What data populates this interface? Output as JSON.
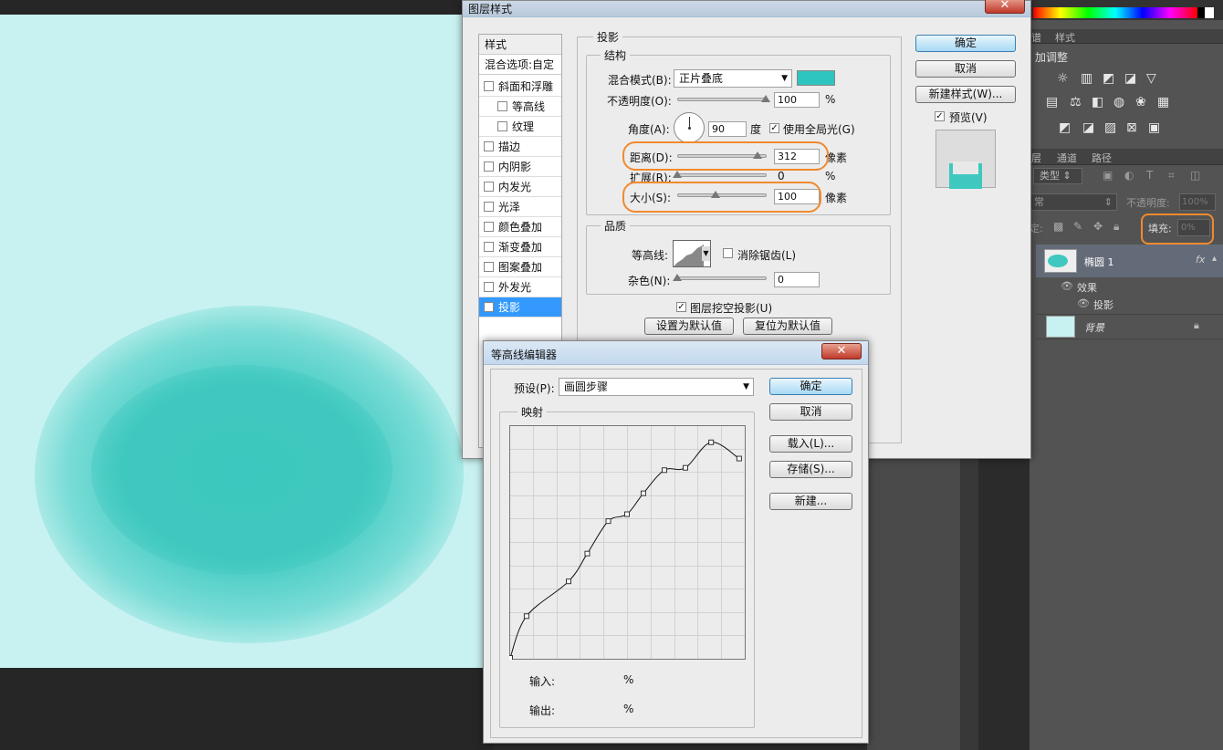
{
  "layer_style": {
    "title": "图层样式",
    "close": "✕",
    "sidebar": {
      "header": "样式",
      "blend_options": "混合选项:自定",
      "items": [
        {
          "label": "斜面和浮雕",
          "checked": false,
          "indent": false
        },
        {
          "label": "等高线",
          "checked": false,
          "indent": true
        },
        {
          "label": "纹理",
          "checked": false,
          "indent": true
        },
        {
          "label": "描边",
          "checked": false,
          "indent": false
        },
        {
          "label": "内阴影",
          "checked": false,
          "indent": false
        },
        {
          "label": "内发光",
          "checked": false,
          "indent": false
        },
        {
          "label": "光泽",
          "checked": false,
          "indent": false
        },
        {
          "label": "颜色叠加",
          "checked": false,
          "indent": false
        },
        {
          "label": "渐变叠加",
          "checked": false,
          "indent": false
        },
        {
          "label": "图案叠加",
          "checked": false,
          "indent": false
        },
        {
          "label": "外发光",
          "checked": false,
          "indent": false
        },
        {
          "label": "投影",
          "checked": true,
          "indent": false,
          "selected": true
        }
      ]
    },
    "section_title": "投影",
    "structure": {
      "title": "结构",
      "blend_mode_label": "混合模式(B):",
      "blend_mode_value": "正片叠底",
      "blend_color": "#2ec4bf",
      "opacity_label": "不透明度(O):",
      "opacity_value": "100",
      "percent": "%",
      "angle_label": "角度(A):",
      "angle_value": "90",
      "angle_unit": "度",
      "global_light_label": "使用全局光(G)",
      "distance_label": "距离(D):",
      "distance_value": "312",
      "px_unit": "像素",
      "spread_label": "扩展(R):",
      "spread_value": "0",
      "size_label": "大小(S):",
      "size_value": "100"
    },
    "quality": {
      "title": "品质",
      "contour_label": "等高线:",
      "antialias_label": "消除锯齿(L)",
      "noise_label": "杂色(N):",
      "noise_value": "0"
    },
    "knockout_label": "图层挖空投影(U)",
    "set_default": "设置为默认值",
    "reset_default": "复位为默认值",
    "ok": "确定",
    "cancel": "取消",
    "new_style": "新建样式(W)...",
    "preview_label": "预览(V)"
  },
  "contour_editor": {
    "title": "等高线编辑器",
    "close": "✕",
    "preset_label": "预设(P):",
    "preset_value": "画圆步骤",
    "mapping": "映射",
    "input_label": "输入:",
    "output_label": "输出:",
    "percent": "%",
    "ok": "确定",
    "cancel": "取消",
    "load": "载入(L)...",
    "save": "存储(S)...",
    "new": "新建...",
    "curve_points": [
      [
        0,
        0
      ],
      [
        7,
        18
      ],
      [
        25,
        33
      ],
      [
        33,
        45
      ],
      [
        42,
        59
      ],
      [
        50,
        62
      ],
      [
        57,
        71
      ],
      [
        66,
        81
      ],
      [
        75,
        82
      ],
      [
        86,
        93
      ],
      [
        98,
        86
      ]
    ]
  },
  "right_panel": {
    "tabs_top": [
      "谱",
      "样式"
    ],
    "adjust_title": "加调整",
    "tabs_layers": [
      "层",
      "通道",
      "路径"
    ],
    "filter_kind": "类型",
    "blend_normal": "常",
    "opacity_label": "不透明度:",
    "opacity_value": "100%",
    "lock_label": "定:",
    "fill_label": "填充:",
    "fill_value": "0%",
    "layers": [
      {
        "name": "椭圆 1",
        "fx": "fx"
      },
      {
        "name": "效果"
      },
      {
        "name": "投影"
      },
      {
        "name": "背景"
      }
    ]
  }
}
